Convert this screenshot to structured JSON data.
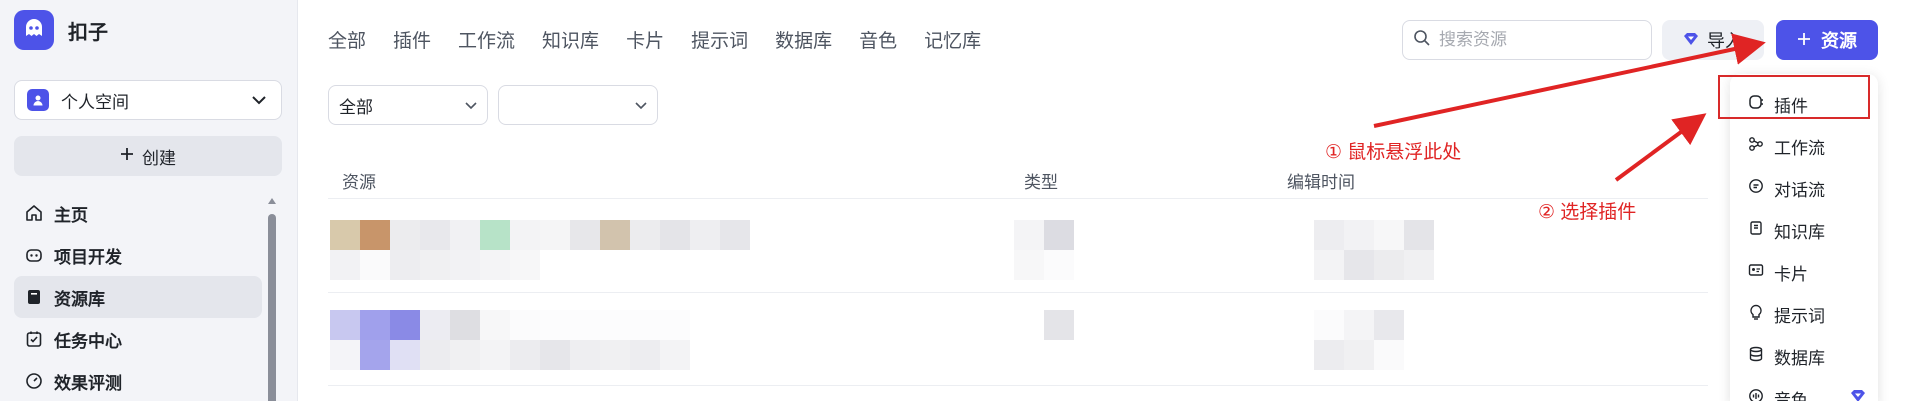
{
  "app": {
    "name": "扣子"
  },
  "sidebar": {
    "space": "个人空间",
    "create_label": "创建",
    "nav": [
      {
        "label": "主页",
        "icon": "home-icon"
      },
      {
        "label": "项目开发",
        "icon": "robot-icon"
      },
      {
        "label": "资源库",
        "icon": "library-icon",
        "active": true
      },
      {
        "label": "任务中心",
        "icon": "task-icon"
      },
      {
        "label": "效果评测",
        "icon": "gauge-icon"
      }
    ]
  },
  "tabs": [
    "全部",
    "插件",
    "工作流",
    "知识库",
    "卡片",
    "提示词",
    "数据库",
    "音色",
    "记忆库"
  ],
  "search": {
    "placeholder": "搜索资源"
  },
  "toolbar": {
    "import_label": "导入",
    "resource_label": "资源"
  },
  "filters": {
    "type_value": "全部",
    "second_value": ""
  },
  "table": {
    "columns": [
      "资源",
      "类型",
      "编辑时间"
    ]
  },
  "dropdown": {
    "items": [
      {
        "label": "插件",
        "icon": "plugin-icon"
      },
      {
        "label": "工作流",
        "icon": "workflow-icon"
      },
      {
        "label": "对话流",
        "icon": "chatflow-icon"
      },
      {
        "label": "知识库",
        "icon": "knowledge-icon"
      },
      {
        "label": "卡片",
        "icon": "card-icon"
      },
      {
        "label": "提示词",
        "icon": "prompt-icon"
      },
      {
        "label": "数据库",
        "icon": "database-icon"
      },
      {
        "label": "音色",
        "icon": "voice-icon"
      }
    ]
  },
  "annotations": {
    "step1": "① 鼠标悬浮此处",
    "step2": "② 选择插件"
  },
  "colors": {
    "accent": "#4d53e8",
    "annotation": "#e02424"
  }
}
